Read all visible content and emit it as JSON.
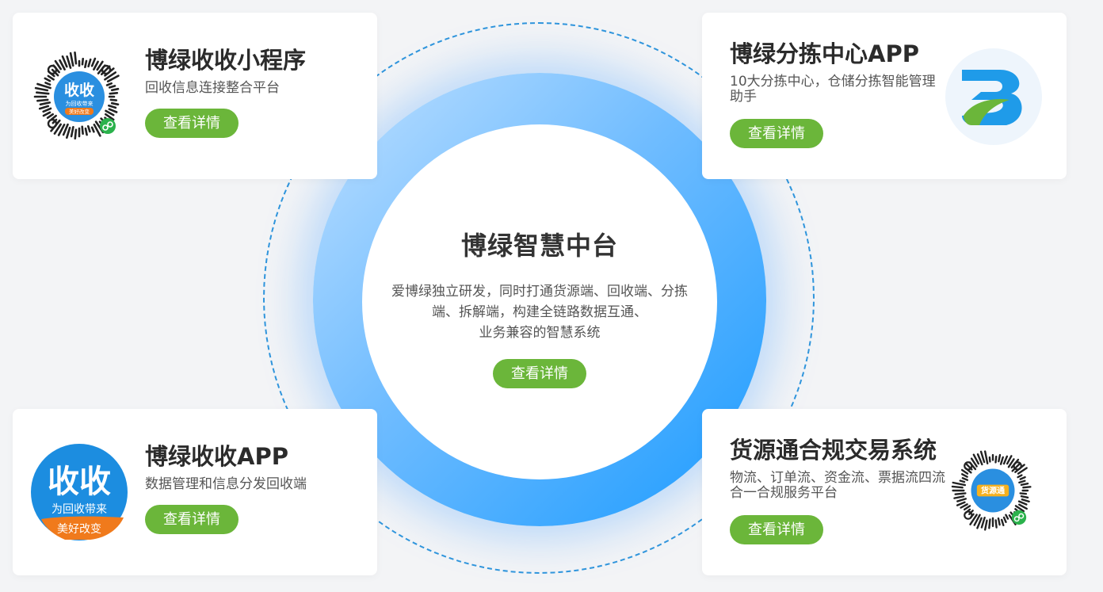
{
  "center": {
    "title": "博绿智慧中台",
    "description": "爱博绿独立研发，同时打通货源端、回收端、分拣\n端、拆解端，构建全链路数据互通、\n业务兼容的智慧系统",
    "button": "查看详情"
  },
  "cards": {
    "top_left": {
      "title": "博绿收收小程序",
      "description": "回收信息连接整合平台",
      "button": "查看详情",
      "image_icon": "mini-program-qr-code",
      "logo_text": "收收",
      "logo_sub": "为回收带来",
      "logo_sub2": "美好改变"
    },
    "top_right": {
      "title": "博绿分拣中心APP",
      "description": "10大分拣中心，仓储分拣智能管理助手",
      "button": "查看详情",
      "image_icon": "bolv-b-logo"
    },
    "bottom_left": {
      "title": "博绿收收APP",
      "description": "数据管理和信息分发回收端",
      "button": "查看详情",
      "image_icon": "shoushou-app-logo",
      "logo_text": "收收",
      "logo_sub": "为回收带来",
      "logo_sub2": "美好改变"
    },
    "bottom_right": {
      "title": "货源通合规交易系统",
      "description": "物流、订单流、资金流、票据流四流合一合规服务平台",
      "button": "查看详情",
      "image_icon": "mini-program-qr-code",
      "logo_text": "货源通"
    }
  },
  "colors": {
    "accent_green": "#6bb63a",
    "ring_blue": "#1b9bff",
    "orbit_dash": "#2f95dc"
  }
}
